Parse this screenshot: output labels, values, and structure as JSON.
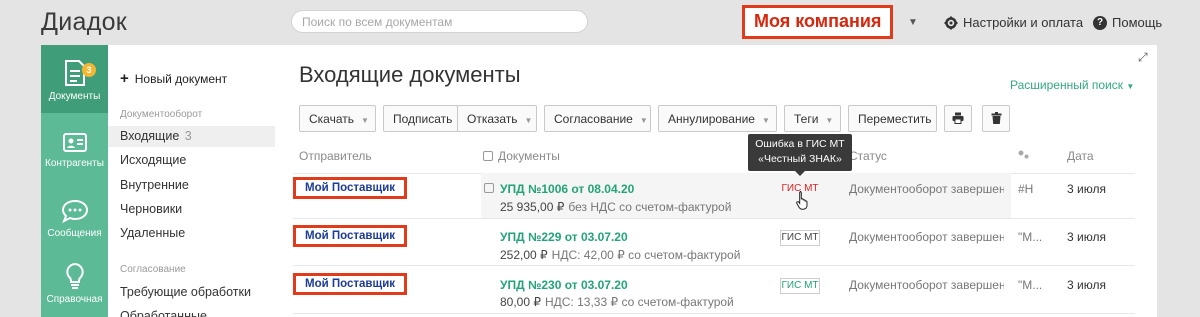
{
  "header": {
    "logo": "Диадок",
    "search_placeholder": "Поиск по всем документам",
    "company": "Моя компания",
    "settings": "Настройки и оплата",
    "help": "Помощь"
  },
  "nav": {
    "documents": "Документы",
    "documents_badge": "3",
    "counterparties": "Контрагенты",
    "messages": "Сообщения",
    "reference": "Справочная"
  },
  "subnav": {
    "new_doc": "Новый документ",
    "section_flow": "Документооборот",
    "incoming": "Входящие",
    "incoming_count": "3",
    "outgoing": "Исходящие",
    "internal": "Внутренние",
    "drafts": "Черновики",
    "deleted": "Удаленные",
    "section_approval": "Согласование",
    "requiring": "Требующие обработки",
    "processed": "Обработанные"
  },
  "main": {
    "title": "Входящие документы",
    "advanced_search": "Расширенный поиск",
    "toolbar": {
      "download": "Скачать",
      "sign": "Подписать",
      "reject": "Отказать",
      "approval": "Согласование",
      "annul": "Аннулирование",
      "tags": "Теги",
      "move": "Переместить"
    },
    "columns": {
      "sender": "Отправитель",
      "documents": "Документы",
      "status": "Статус",
      "date": "Дата"
    },
    "tooltip": {
      "line1": "Ошибка в ГИС МТ",
      "line2": "«Честный ЗНАК»"
    },
    "rows": [
      {
        "sender": "Мой Поставщик",
        "title": "УПД №1006 от 08.04.20",
        "amount": "25 935,00 ₽",
        "vat": "без НДС со счетом-фактурой",
        "gis": "ГИС МТ",
        "status": "Документооборот завершен",
        "tag": "#Н",
        "date": "3 июля"
      },
      {
        "sender": "Мой Поставщик",
        "title": "УПД №229 от 03.07.20",
        "amount": "252,00 ₽",
        "vat": "НДС: 42,00 ₽ со счетом-фактурой",
        "gis": "ГИС МТ",
        "status": "Документооборот завершен",
        "tag": "\"М...",
        "date": "3 июля"
      },
      {
        "sender": "Мой Поставщик",
        "title": "УПД №230 от 03.07.20",
        "amount": "80,00 ₽",
        "vat": "НДС: 13,33 ₽ со счетом-фактурой",
        "gis": "ГИС МТ",
        "status": "Документооборот завершен",
        "tag": "\"М...",
        "date": "3 июля"
      }
    ]
  },
  "colors": {
    "green": "#5cba96",
    "green_active": "#3f9d79",
    "link_green": "#23a477",
    "highlight_red": "#e23b1b",
    "sender_blue": "#1b3c98"
  }
}
